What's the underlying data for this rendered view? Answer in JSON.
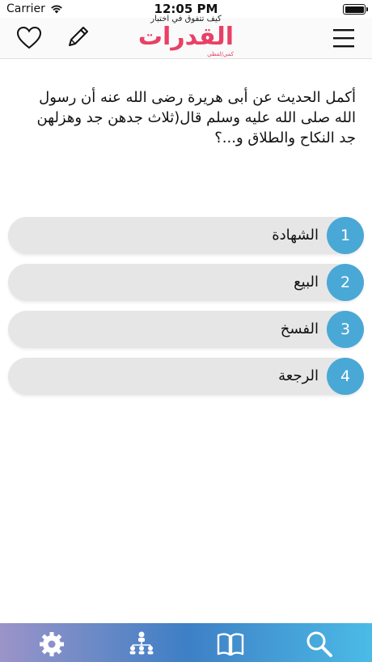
{
  "status_bar": {
    "carrier": "Carrier",
    "time": "12:05 PM"
  },
  "header": {
    "logo_tagline": "كيف تتفوق في اختبار",
    "logo_title": "القدرات",
    "logo_sub": "كمي/لفظي"
  },
  "question": {
    "text": "أكمل الحديث عن أبى هريرة رضى الله عنه أن رسول الله صلى الله عليه وسلم قال(ثلاث جدهن جد وهزلهن جد النكاح والطلاق و...؟"
  },
  "options": [
    {
      "num": "1",
      "label": "الشهادة"
    },
    {
      "num": "2",
      "label": "البيع"
    },
    {
      "num": "3",
      "label": "الفسخ"
    },
    {
      "num": "4",
      "label": "الرجعة"
    }
  ],
  "tab_bar": {
    "icons": [
      "gear-icon",
      "hierarchy-icon",
      "book-icon",
      "search-icon"
    ]
  },
  "colors": {
    "accent": "#4aa8d6",
    "logo": "#e94066",
    "option_bg": "#e6e6e6"
  }
}
